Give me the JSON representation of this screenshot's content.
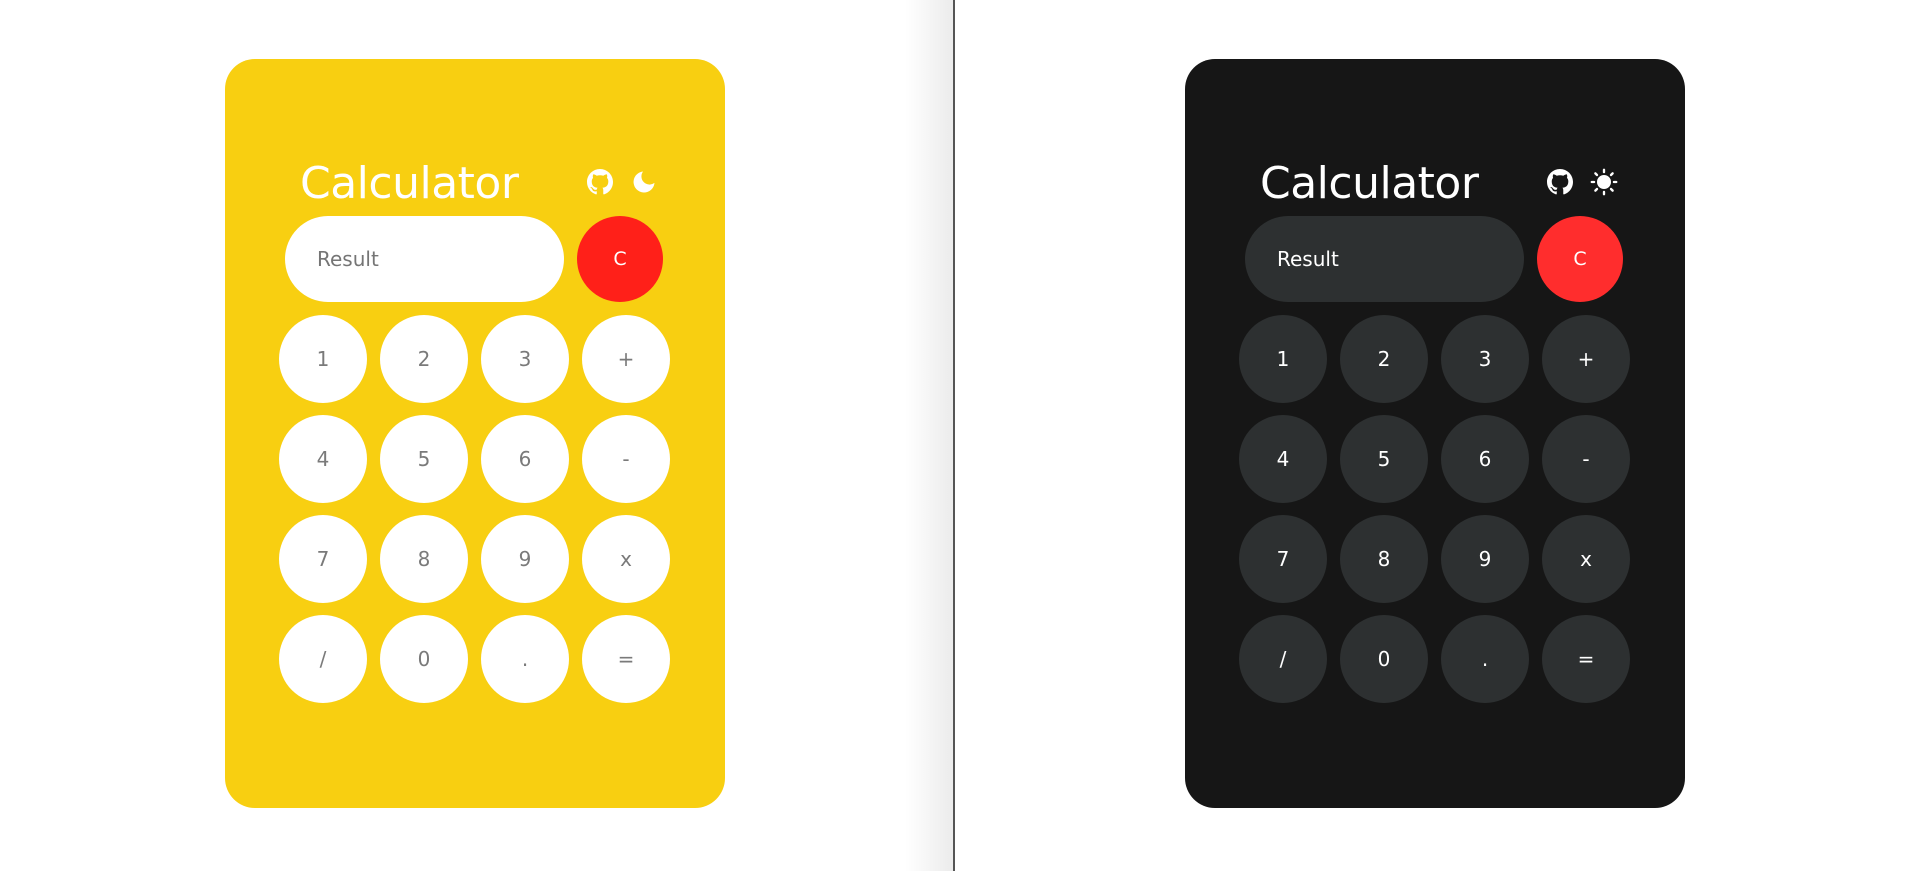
{
  "colors": {
    "light_card": "#f8cf11",
    "dark_card": "#161616",
    "clear_button": "#ff2019",
    "dark_key": "#2d3031",
    "light_key": "#ffffff"
  },
  "light": {
    "title": "Calculator",
    "icons": [
      "github-icon",
      "moon-icon"
    ],
    "display_placeholder": "Result",
    "clear_label": "C",
    "keys": [
      "1",
      "2",
      "3",
      "+",
      "4",
      "5",
      "6",
      "-",
      "7",
      "8",
      "9",
      "x",
      "/",
      "0",
      ".",
      "="
    ]
  },
  "dark": {
    "title": "Calculator",
    "icons": [
      "github-icon",
      "sun-icon"
    ],
    "display_placeholder": "Result",
    "clear_label": "C",
    "keys": [
      "1",
      "2",
      "3",
      "+",
      "4",
      "5",
      "6",
      "-",
      "7",
      "8",
      "9",
      "x",
      "/",
      "0",
      ".",
      "="
    ]
  }
}
